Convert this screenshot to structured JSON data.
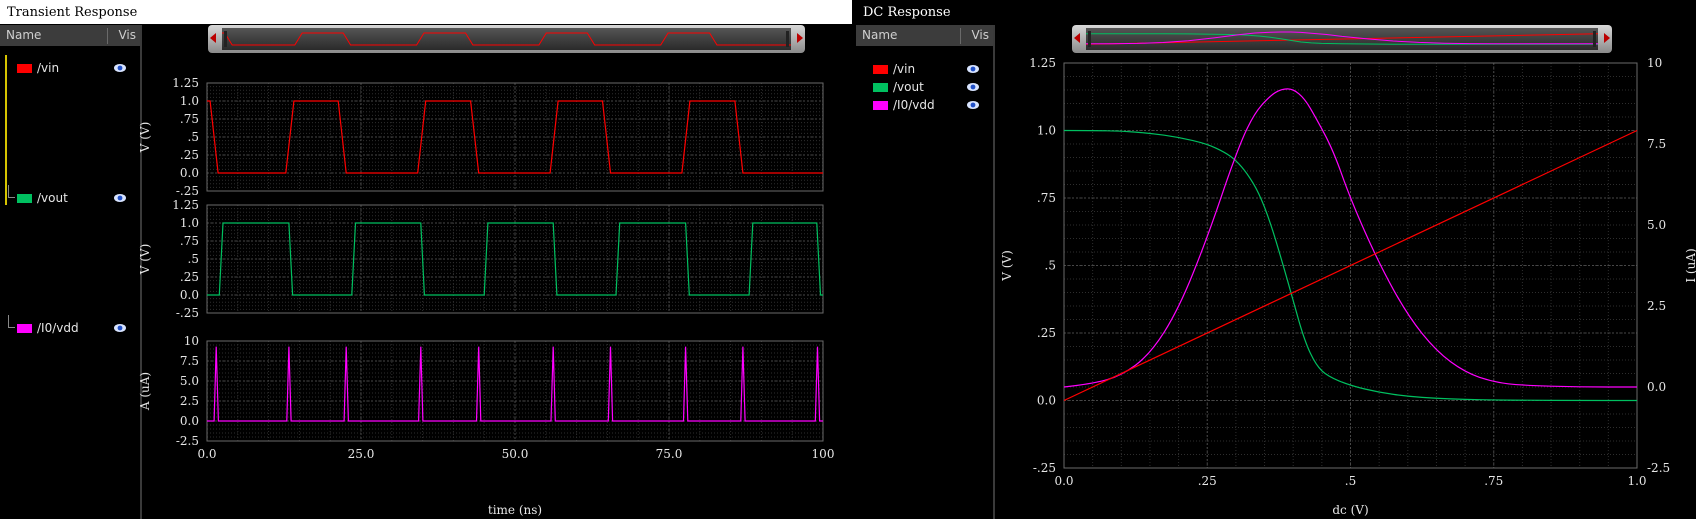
{
  "left_panel": {
    "title": "Transient Response",
    "sidebar": {
      "col_name": "Name",
      "col_vis": "Vis"
    },
    "signals": [
      {
        "name": "/vin",
        "color": "#ff0000"
      },
      {
        "name": "/vout",
        "color": "#00c060"
      },
      {
        "name": "/I0/vdd",
        "color": "#ff00ff"
      }
    ]
  },
  "right_panel": {
    "title": "DC Response",
    "sidebar": {
      "col_name": "Name",
      "col_vis": "Vis"
    },
    "signals": [
      {
        "name": "/vin",
        "color": "#ff0000"
      },
      {
        "name": "/vout",
        "color": "#00c060"
      },
      {
        "name": "/I0/vdd",
        "color": "#ff00ff"
      }
    ]
  },
  "chart_data": [
    {
      "type": "line",
      "title": "Transient Response",
      "xlabel": "time (ns)",
      "xlim": [
        0,
        100
      ],
      "xticks": [
        "0.0",
        "25.0",
        "50.0",
        "75.0",
        "100"
      ],
      "grid": true,
      "subplots": [
        {
          "series_name": "/vin",
          "color": "#ff0000",
          "ylabel": "V (V)",
          "ylim": [
            -0.25,
            1.25
          ],
          "yticks": [
            "1.25",
            "1.0",
            ".75",
            ".5",
            ".25",
            "0.0",
            "-.25"
          ],
          "high": 1.0,
          "low": 0.0,
          "x_low_starts": [
            0.5,
            21.3,
            42.8,
            64.2,
            85.7
          ],
          "x_high_starts": [
            12.8,
            34.2,
            55.7,
            77.1
          ],
          "edge_width": 1.3
        },
        {
          "series_name": "/vout",
          "color": "#00c060",
          "ylabel": "V (V)",
          "ylim": [
            -0.25,
            1.25
          ],
          "yticks": [
            "1.25",
            "1.0",
            ".75",
            ".5",
            ".25",
            "0.0",
            "-.25"
          ],
          "high": 1.0,
          "low": 0.0,
          "x_high_starts": [
            2.0,
            23.5,
            45.0,
            66.4,
            88.0
          ],
          "x_low_starts": [
            13.3,
            34.7,
            56.2,
            77.7,
            99.0
          ],
          "edge_width": 0.6
        },
        {
          "series_name": "/I0/vdd",
          "color": "#ff00ff",
          "ylabel": "A (uA)",
          "ylim": [
            -2.5,
            10
          ],
          "yticks": [
            "10",
            "7.5",
            "5.0",
            "2.5",
            "0.0",
            "-2.5"
          ],
          "baseline": 0.0,
          "spike_peak": 9.3,
          "spike_x": [
            1.5,
            13.3,
            22.6,
            34.7,
            44.1,
            56.2,
            65.5,
            77.7,
            87.0,
            99.1
          ]
        }
      ]
    },
    {
      "type": "line",
      "title": "DC Response",
      "xlabel": "dc (V)",
      "ylabel_left": "V (V)",
      "ylabel_right": "I (uA)",
      "xlim": [
        0,
        1.0
      ],
      "ylim_left": [
        -0.25,
        1.25
      ],
      "ylim_right": [
        -2.5,
        10
      ],
      "xticks": [
        "0.0",
        ".25",
        ".5",
        ".75",
        "1.0"
      ],
      "yticks_left": [
        "1.25",
        "1.0",
        ".75",
        ".5",
        ".25",
        "0.0",
        "-.25"
      ],
      "yticks_right": [
        "10",
        "7.5",
        "5.0",
        "2.5",
        "0.0",
        "-2.5"
      ],
      "grid": true,
      "series": [
        {
          "name": "/vin",
          "axis": "left",
          "color": "#ff0000",
          "x": [
            0.0,
            1.0
          ],
          "y": [
            0.0,
            1.0
          ]
        },
        {
          "name": "/vout",
          "axis": "left",
          "color": "#00c060",
          "x": [
            0.0,
            0.05,
            0.1,
            0.15,
            0.2,
            0.25,
            0.28,
            0.3,
            0.32,
            0.34,
            0.36,
            0.38,
            0.4,
            0.42,
            0.44,
            0.46,
            0.5,
            0.55,
            0.6,
            0.65,
            0.7,
            0.75,
            0.8,
            0.9,
            1.0
          ],
          "y": [
            1.0,
            1.0,
            0.998,
            0.99,
            0.975,
            0.95,
            0.92,
            0.89,
            0.84,
            0.77,
            0.66,
            0.52,
            0.37,
            0.22,
            0.13,
            0.09,
            0.055,
            0.03,
            0.015,
            0.008,
            0.004,
            0.002,
            0.001,
            0.0,
            0.0
          ]
        },
        {
          "name": "/I0/vdd",
          "axis": "right",
          "color": "#ff00ff",
          "x": [
            0.0,
            0.05,
            0.1,
            0.15,
            0.2,
            0.25,
            0.3,
            0.33,
            0.36,
            0.38,
            0.4,
            0.42,
            0.44,
            0.47,
            0.5,
            0.55,
            0.6,
            0.65,
            0.7,
            0.75,
            0.8,
            0.9,
            1.0
          ],
          "y": [
            0.0,
            0.1,
            0.35,
            1.0,
            2.4,
            4.6,
            7.2,
            8.4,
            9.0,
            9.2,
            9.2,
            8.9,
            8.3,
            7.3,
            5.8,
            3.8,
            2.2,
            1.1,
            0.45,
            0.15,
            0.05,
            0.0,
            0.0
          ]
        }
      ]
    }
  ]
}
